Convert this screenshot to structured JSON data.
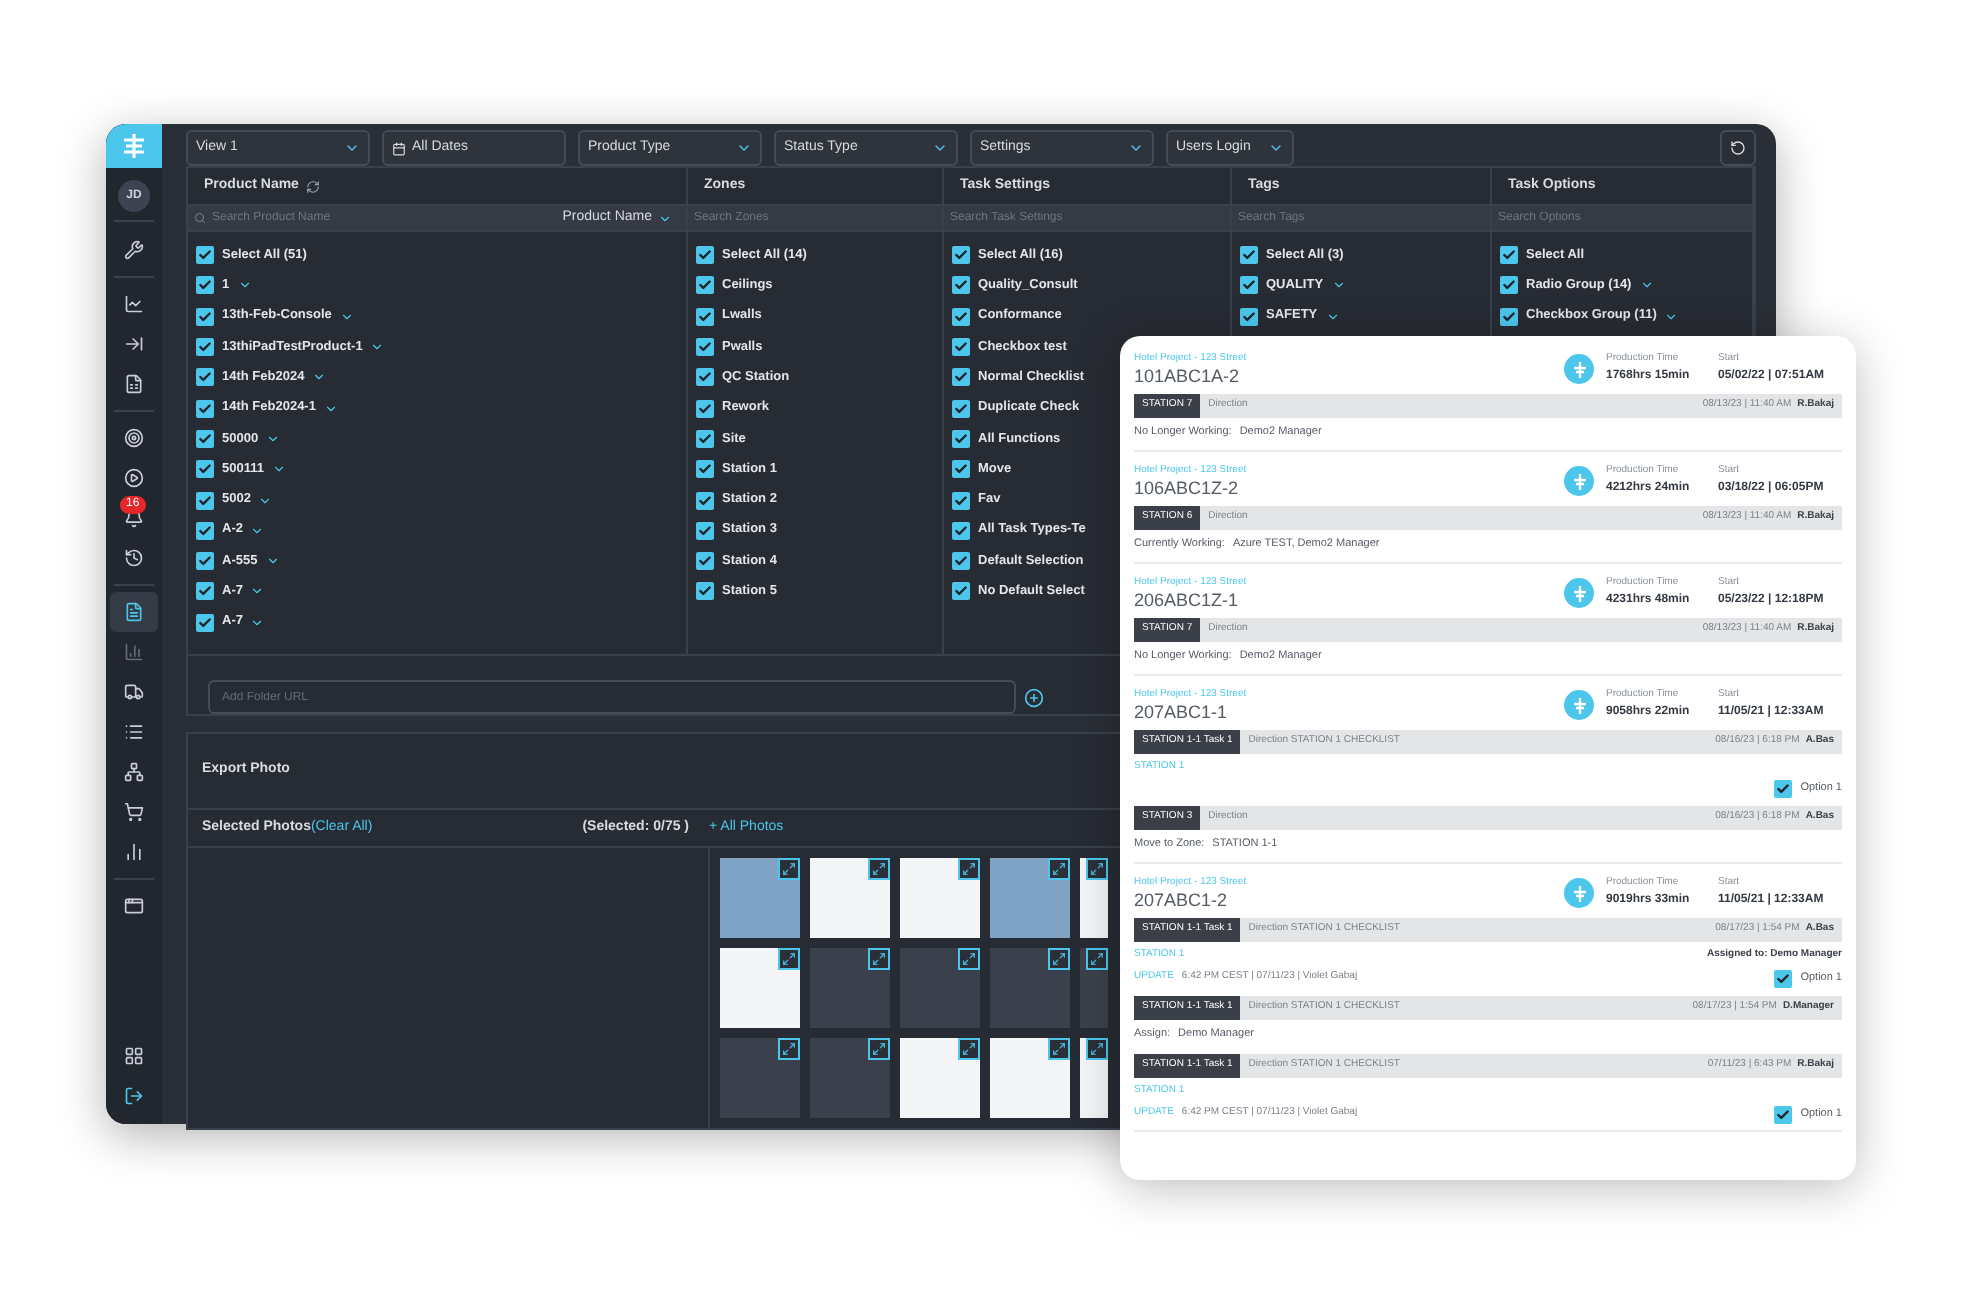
{
  "sidebar": {
    "avatar": "JD",
    "badge": "16",
    "items": [
      {
        "selected": false,
        "disabled": false
      },
      {
        "selected": false,
        "disabled": false
      },
      {
        "selected": false,
        "disabled": false
      },
      {
        "selected": false,
        "disabled": false
      },
      {
        "selected": false,
        "disabled": false
      },
      {
        "selected": false,
        "disabled": false
      },
      {
        "selected": false,
        "disabled": false
      },
      {
        "selected": false,
        "disabled": false
      },
      {
        "selected": true,
        "disabled": false
      },
      {
        "selected": false,
        "disabled": true
      },
      {
        "selected": false,
        "disabled": false
      },
      {
        "selected": false,
        "disabled": false
      },
      {
        "selected": false,
        "disabled": false
      },
      {
        "selected": false,
        "disabled": false
      },
      {
        "selected": false,
        "disabled": false
      },
      {
        "selected": false,
        "disabled": false
      },
      {
        "selected": false,
        "disabled": false
      },
      {
        "selected": false,
        "disabled": false
      }
    ]
  },
  "toolbar": {
    "filters": [
      {
        "kind": "dropdown",
        "label": "View 1"
      },
      {
        "kind": "date",
        "label": "All Dates"
      },
      {
        "kind": "dropdown",
        "label": "Product Type"
      },
      {
        "kind": "dropdown",
        "label": "Status Type"
      },
      {
        "kind": "dropdown",
        "label": "Settings"
      },
      {
        "kind": "dropdown",
        "label": "Users Login"
      }
    ]
  },
  "filter_panel": {
    "columns": [
      {
        "title": "Product Name",
        "placeholder": "Search Product Name",
        "sort": "Product Name",
        "items": [
          {
            "label": "Select All (51)",
            "checked": true,
            "expandable": false
          },
          {
            "label": "1",
            "checked": true,
            "expandable": true
          },
          {
            "label": "13th-Feb-Console",
            "checked": true,
            "expandable": true
          },
          {
            "label": "13thiPadTestProduct-1",
            "checked": true,
            "expandable": true
          },
          {
            "label": "14th Feb2024",
            "checked": true,
            "expandable": true
          },
          {
            "label": "14th Feb2024-1",
            "checked": true,
            "expandable": true
          },
          {
            "label": "50000",
            "checked": true,
            "expandable": true
          },
          {
            "label": "500111",
            "checked": true,
            "expandable": true
          },
          {
            "label": "5002",
            "checked": true,
            "expandable": true
          },
          {
            "label": "A-2",
            "checked": true,
            "expandable": true
          },
          {
            "label": "A-555",
            "checked": true,
            "expandable": true
          },
          {
            "label": "A-7",
            "checked": true,
            "expandable": true
          },
          {
            "label": "A-7",
            "checked": true,
            "expandable": true
          }
        ]
      },
      {
        "title": "Zones",
        "placeholder": "Search Zones",
        "items": [
          {
            "label": "Select All (14)",
            "checked": true,
            "expandable": false
          },
          {
            "label": "Ceilings",
            "checked": true,
            "expandable": false
          },
          {
            "label": "Lwalls",
            "checked": true,
            "expandable": false
          },
          {
            "label": "Pwalls",
            "checked": true,
            "expandable": false
          },
          {
            "label": "QC Station",
            "checked": true,
            "expandable": false
          },
          {
            "label": "Rework",
            "checked": true,
            "expandable": false
          },
          {
            "label": "Site",
            "checked": true,
            "expandable": false
          },
          {
            "label": "Station 1",
            "checked": true,
            "expandable": false
          },
          {
            "label": "Station 2",
            "checked": true,
            "expandable": false
          },
          {
            "label": "Station 3",
            "checked": true,
            "expandable": false
          },
          {
            "label": "Station 4",
            "checked": true,
            "expandable": false
          },
          {
            "label": "Station 5",
            "checked": true,
            "expandable": false
          }
        ]
      },
      {
        "title": "Task Settings",
        "placeholder": "Search Task Settings",
        "items": [
          {
            "label": "Select All (16)",
            "checked": true,
            "expandable": false
          },
          {
            "label": "Quality_Consult",
            "checked": true,
            "expandable": false
          },
          {
            "label": "Conformance",
            "checked": true,
            "expandable": false
          },
          {
            "label": "Checkbox test",
            "checked": true,
            "expandable": false
          },
          {
            "label": "Normal Checklist",
            "checked": true,
            "expandable": false
          },
          {
            "label": "Duplicate Check",
            "checked": true,
            "expandable": false
          },
          {
            "label": "All Functions",
            "checked": true,
            "expandable": false
          },
          {
            "label": "Move",
            "checked": true,
            "expandable": false
          },
          {
            "label": "Fav",
            "checked": true,
            "expandable": false
          },
          {
            "label": "All Task Types-Te",
            "checked": true,
            "expandable": false
          },
          {
            "label": "Default Selection",
            "checked": true,
            "expandable": false
          },
          {
            "label": "No Default Select",
            "checked": true,
            "expandable": false
          }
        ]
      },
      {
        "title": "Tags",
        "placeholder": "Search Tags",
        "items": [
          {
            "label": "Select All (3)",
            "checked": true,
            "expandable": false
          },
          {
            "label": "QUALITY",
            "checked": true,
            "expandable": true
          },
          {
            "label": "SAFETY",
            "checked": true,
            "expandable": true
          }
        ]
      },
      {
        "title": "Task Options",
        "placeholder": "Search Options",
        "items": [
          {
            "label": "Select All",
            "checked": true,
            "expandable": false
          },
          {
            "label": "Radio Group (14)",
            "checked": true,
            "expandable": true
          },
          {
            "label": "Checkbox Group (11)",
            "checked": true,
            "expandable": true
          }
        ]
      }
    ],
    "folder_placeholder": "Add Folder URL"
  },
  "export": {
    "title": "Export Photo",
    "selected_label": "Selected Photos",
    "clear": "(Clear All)",
    "count": "(Selected: 0/75 )",
    "all_photos": "+ All Photos",
    "photos": [
      {
        "kind": "photo"
      },
      {
        "kind": "document"
      },
      {
        "kind": "document"
      },
      {
        "kind": "photo"
      },
      {
        "kind": "document"
      },
      {
        "kind": "document"
      },
      {
        "kind": "screen"
      },
      {
        "kind": "screen"
      },
      {
        "kind": "screen"
      },
      {
        "kind": "screen"
      },
      {
        "kind": "screen"
      },
      {
        "kind": "screen"
      },
      {
        "kind": "document"
      },
      {
        "kind": "document"
      },
      {
        "kind": "document"
      }
    ]
  },
  "job_card": {
    "jobs": [
      {
        "project": "Hotel Project - 123 Street",
        "production_label": "Production Time",
        "start_label": "Start",
        "code": "101ABC1A-2",
        "production_time": "1768hrs 15min",
        "start": "05/02/22 | 07:51AM",
        "entries": [
          {
            "kind": "station",
            "badge": "STATION 7",
            "text": "Direction",
            "time": "08/13/23 | 11:40 AM",
            "user": "R.Bakaj"
          },
          {
            "kind": "note",
            "label": "No Longer Working:",
            "value": "Demo2 Manager"
          }
        ]
      },
      {
        "project": "Hotel Project - 123 Street",
        "production_label": "Production Time",
        "start_label": "Start",
        "code": "106ABC1Z-2",
        "production_time": "4212hrs 24min",
        "start": "03/18/22 | 06:05PM",
        "entries": [
          {
            "kind": "station",
            "badge": "STATION 6",
            "text": "Direction",
            "time": "08/13/23 | 11:40 AM",
            "user": "R.Bakaj"
          },
          {
            "kind": "note",
            "label": "Currently Working:",
            "value": "Azure TEST, Demo2 Manager"
          }
        ]
      },
      {
        "project": "Hotel Project - 123 Street",
        "production_label": "Production Time",
        "start_label": "Start",
        "code": "206ABC1Z-1",
        "production_time": "4231hrs 48min",
        "start": "05/23/22 | 12:18PM",
        "entries": [
          {
            "kind": "station",
            "badge": "STATION 7",
            "text": "Direction",
            "time": "08/13/23 | 11:40 AM",
            "user": "R.Bakaj"
          },
          {
            "kind": "note",
            "label": "No Longer Working:",
            "value": "Demo2 Manager"
          }
        ]
      },
      {
        "project": "Hotel Project - 123 Street",
        "production_label": "Production Time",
        "start_label": "Start",
        "code": "207ABC1-1",
        "production_time": "9058hrs 22min",
        "start": "11/05/21 | 12:33AM",
        "entries": [
          {
            "kind": "station",
            "badge": "STATION 1-1 Task 1",
            "text": "Direction STATION 1 CHECKLIST",
            "time": "08/16/23 | 6:18 PM",
            "user": "A.Bas"
          },
          {
            "kind": "zone",
            "text": "STATION 1"
          },
          {
            "kind": "option",
            "label": "Option 1",
            "checked": true
          },
          {
            "kind": "station",
            "badge": "STATION 3",
            "text": "Direction",
            "time": "08/16/23 | 6:18 PM",
            "user": "A.Bas"
          },
          {
            "kind": "note",
            "label": "Move to Zone:",
            "value": "STATION 1-1"
          }
        ]
      },
      {
        "project": "Hotel Project - 123 Street",
        "production_label": "Production Time",
        "start_label": "Start",
        "code": "207ABC1-2",
        "production_time": "9019hrs 33min",
        "start": "11/05/21 | 12:33AM",
        "entries": [
          {
            "kind": "station",
            "badge": "STATION 1-1 Task 1",
            "text": "Direction STATION 1 CHECKLIST",
            "time": "08/17/23 | 1:54 PM",
            "user": "A.Bas"
          },
          {
            "kind": "zone",
            "text": "STATION 1",
            "right": "Assigned to: Demo Manager"
          },
          {
            "kind": "update",
            "tag": "UPDATE",
            "text": "6:42 PM CEST | 07/11/23 | Violet Gabaj",
            "option": "Option 1",
            "checked": true
          },
          {
            "kind": "station",
            "badge": "STATION 1-1 Task 1",
            "text": "Direction STATION 1 CHECKLIST",
            "time": "08/17/23 | 1:54 PM",
            "user": "D.Manager"
          },
          {
            "kind": "note",
            "label": "Assign:",
            "value": "Demo Manager"
          },
          {
            "kind": "station",
            "badge": "STATION 1-1 Task 1",
            "text": "Direction STATION 1 CHECKLIST",
            "time": "07/11/23 | 6:43 PM",
            "user": "R.Bakaj"
          },
          {
            "kind": "zone",
            "text": "STATION 1"
          },
          {
            "kind": "update",
            "tag": "UPDATE",
            "text": "6:42 PM CEST | 07/11/23 | Violet Gabaj",
            "option": "Option 1",
            "checked": true
          }
        ]
      }
    ]
  }
}
